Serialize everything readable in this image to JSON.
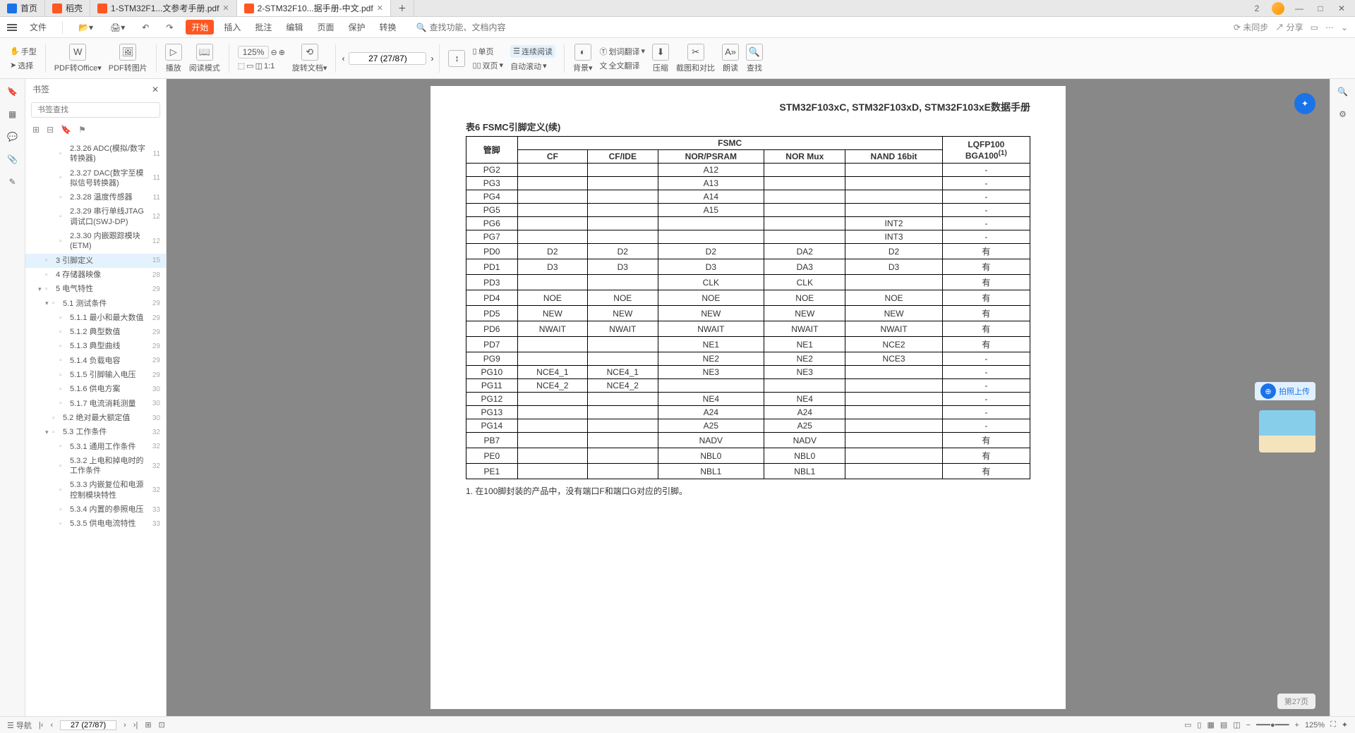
{
  "tabs": [
    {
      "label": "首页",
      "type": "home"
    },
    {
      "label": "稻壳",
      "type": "app"
    },
    {
      "label": "1-STM32F1...文参考手册.pdf",
      "type": "pdf"
    },
    {
      "label": "2-STM32F10...据手册-中文.pdf",
      "type": "pdf",
      "active": true
    }
  ],
  "window": {
    "badge": "2"
  },
  "menubar": {
    "file": "文件",
    "tabs": [
      "开始",
      "插入",
      "批注",
      "编辑",
      "页面",
      "保护",
      "转换"
    ],
    "search_placeholder": "查找功能、文档内容",
    "right": {
      "nosync": "未同步",
      "share": "分享"
    }
  },
  "toolbar": {
    "hand": "手型",
    "select": "选择",
    "pdf2office": "PDF转Office",
    "pdf2img": "PDF转图片",
    "play": "播放",
    "readmode": "阅读模式",
    "zoom": "125%",
    "rotate": "旋转文档",
    "page_display": "27 (27/87)",
    "single": "单页",
    "double": "双页",
    "continuous": "连续阅读",
    "autoscroll": "自动滚动",
    "bg": "背景",
    "word_trans": "划词翻译",
    "full_trans": "全文翻译",
    "compress": "压缩",
    "screenshot": "截图和对比",
    "read_aloud": "朗读",
    "find": "查找"
  },
  "sidepanel": {
    "title": "书签",
    "search_placeholder": "书签查找",
    "bookmarks": [
      {
        "text": "2.3.26 ADC(模拟/数字转换器)",
        "page": "11",
        "indent": 3
      },
      {
        "text": "2.3.27 DAC(数字至模拟信号转换器)",
        "page": "11",
        "indent": 3
      },
      {
        "text": "2.3.28 温度传感器",
        "page": "11",
        "indent": 3
      },
      {
        "text": "2.3.29 串行单线JTAG调试口(SWJ-DP)",
        "page": "12",
        "indent": 3
      },
      {
        "text": "2.3.30 内嵌跟踪模块(ETM)",
        "page": "12",
        "indent": 3
      },
      {
        "text": "3 引脚定义",
        "page": "15",
        "indent": 1,
        "selected": true
      },
      {
        "text": "4 存储器映像",
        "page": "28",
        "indent": 1
      },
      {
        "text": "5 电气特性",
        "page": "29",
        "indent": 1,
        "exp": "▾"
      },
      {
        "text": "5.1 测试条件",
        "page": "29",
        "indent": 2,
        "exp": "▾"
      },
      {
        "text": "5.1.1 最小和最大数值",
        "page": "29",
        "indent": 3
      },
      {
        "text": "5.1.2 典型数值",
        "page": "29",
        "indent": 3
      },
      {
        "text": "5.1.3 典型曲线",
        "page": "29",
        "indent": 3
      },
      {
        "text": "5.1.4 负载电容",
        "page": "29",
        "indent": 3
      },
      {
        "text": "5.1.5 引脚输入电压",
        "page": "29",
        "indent": 3
      },
      {
        "text": "5.1.6 供电方案",
        "page": "30",
        "indent": 3
      },
      {
        "text": "5.1.7 电流消耗测量",
        "page": "30",
        "indent": 3
      },
      {
        "text": "5.2 绝对最大额定值",
        "page": "30",
        "indent": 2
      },
      {
        "text": "5.3 工作条件",
        "page": "32",
        "indent": 2,
        "exp": "▾"
      },
      {
        "text": "5.3.1 通用工作条件",
        "page": "32",
        "indent": 3
      },
      {
        "text": "5.3.2 上电和掉电时的工作条件",
        "page": "32",
        "indent": 3
      },
      {
        "text": "5.3.3 内嵌复位和电源控制模块特性",
        "page": "32",
        "indent": 3
      },
      {
        "text": "5.3.4 内置的参照电压",
        "page": "33",
        "indent": 3
      },
      {
        "text": "5.3.5 供电电流特性",
        "page": "33",
        "indent": 3
      }
    ]
  },
  "document": {
    "title": "STM32F103xC, STM32F103xD, STM32F103xE数据手册",
    "table_caption": "表6   FSMC引脚定义(续)",
    "headers": {
      "pin": "管脚",
      "fsmc": "FSMC",
      "cols": [
        "CF",
        "CF/IDE",
        "NOR/PSRAM",
        "NOR Mux",
        "NAND 16bit"
      ],
      "pkg1": "LQFP100",
      "pkg2": "BGA100",
      "sup": "(1)"
    },
    "rows": [
      {
        "pin": "PG2",
        "c": [
          "",
          "",
          "A12",
          "",
          ""
        ],
        "p": "-"
      },
      {
        "pin": "PG3",
        "c": [
          "",
          "",
          "A13",
          "",
          ""
        ],
        "p": "-"
      },
      {
        "pin": "PG4",
        "c": [
          "",
          "",
          "A14",
          "",
          ""
        ],
        "p": "-"
      },
      {
        "pin": "PG5",
        "c": [
          "",
          "",
          "A15",
          "",
          ""
        ],
        "p": "-"
      },
      {
        "pin": "PG6",
        "c": [
          "",
          "",
          "",
          "",
          "INT2"
        ],
        "p": "-"
      },
      {
        "pin": "PG7",
        "c": [
          "",
          "",
          "",
          "",
          "INT3"
        ],
        "p": "-"
      },
      {
        "pin": "PD0",
        "c": [
          "D2",
          "D2",
          "D2",
          "DA2",
          "D2"
        ],
        "p": "有"
      },
      {
        "pin": "PD1",
        "c": [
          "D3",
          "D3",
          "D3",
          "DA3",
          "D3"
        ],
        "p": "有"
      },
      {
        "pin": "PD3",
        "c": [
          "",
          "",
          "CLK",
          "CLK",
          ""
        ],
        "p": "有"
      },
      {
        "pin": "PD4",
        "c": [
          "NOE",
          "NOE",
          "NOE",
          "NOE",
          "NOE"
        ],
        "p": "有"
      },
      {
        "pin": "PD5",
        "c": [
          "NEW",
          "NEW",
          "NEW",
          "NEW",
          "NEW"
        ],
        "p": "有"
      },
      {
        "pin": "PD6",
        "c": [
          "NWAIT",
          "NWAIT",
          "NWAIT",
          "NWAIT",
          "NWAIT"
        ],
        "p": "有"
      },
      {
        "pin": "PD7",
        "c": [
          "",
          "",
          "NE1",
          "NE1",
          "NCE2"
        ],
        "p": "有"
      },
      {
        "pin": "PG9",
        "c": [
          "",
          "",
          "NE2",
          "NE2",
          "NCE3"
        ],
        "p": "-"
      },
      {
        "pin": "PG10",
        "c": [
          "NCE4_1",
          "NCE4_1",
          "NE3",
          "NE3",
          ""
        ],
        "p": "-"
      },
      {
        "pin": "PG11",
        "c": [
          "NCE4_2",
          "NCE4_2",
          "",
          "",
          ""
        ],
        "p": "-"
      },
      {
        "pin": "PG12",
        "c": [
          "",
          "",
          "NE4",
          "NE4",
          ""
        ],
        "p": "-"
      },
      {
        "pin": "PG13",
        "c": [
          "",
          "",
          "A24",
          "A24",
          ""
        ],
        "p": "-"
      },
      {
        "pin": "PG14",
        "c": [
          "",
          "",
          "A25",
          "A25",
          ""
        ],
        "p": "-"
      },
      {
        "pin": "PB7",
        "c": [
          "",
          "",
          "NADV",
          "NADV",
          ""
        ],
        "p": "有"
      },
      {
        "pin": "PE0",
        "c": [
          "",
          "",
          "NBL0",
          "NBL0",
          ""
        ],
        "p": "有"
      },
      {
        "pin": "PE1",
        "c": [
          "",
          "",
          "NBL1",
          "NBL1",
          ""
        ],
        "p": "有"
      }
    ],
    "footnote": "1.  在100脚封装的产品中，没有端口F和端口G对应的引脚。"
  },
  "float": {
    "upload": "拍照上传",
    "page_badge": "第27页"
  },
  "statusbar": {
    "nav": "导航",
    "page": "27 (27/87)",
    "zoom": "125%"
  }
}
